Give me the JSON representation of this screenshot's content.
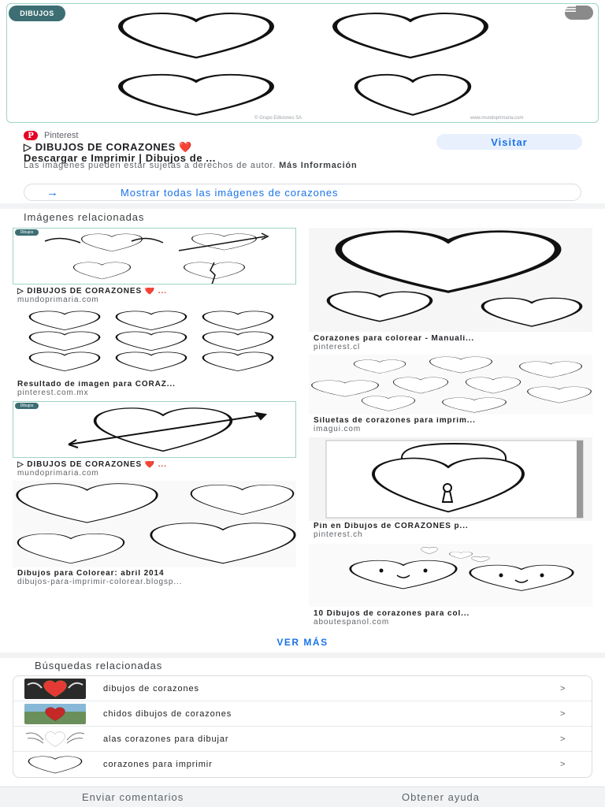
{
  "hero": {
    "logo_text": "DIBUJOS",
    "footer_left": "© Grupo Ediciones SA",
    "footer_right": "www.mundoprimaria.com"
  },
  "result": {
    "source": "Pinterest",
    "title_prefix": "▷ DIBUJOS DE CORAZONES",
    "title_heart": "❤️",
    "title_line2": "Descargar e Imprimir | Dibujos de ...",
    "visit_label": "Visitar",
    "copyright_text": "Las imágenes pueden estar sujetas a derechos de autor.",
    "more_info": "Más Información",
    "show_all_arrow": "→",
    "show_all_label": "Mostrar todas las imágenes de corazones"
  },
  "related_images": {
    "section_title": "Imágenes relacionadas",
    "left": [
      {
        "title": "▷ DIBUJOS DE CORAZONES",
        "heart": "❤️ ...",
        "site": "mundoprimaria.com",
        "badge": "Dibujos"
      },
      {
        "title": "Resultado de imagen para CORAZ...",
        "heart": "",
        "site": "pinterest.com.mx",
        "badge": ""
      },
      {
        "title": "▷ DIBUJOS DE CORAZONES",
        "heart": "❤️ ...",
        "site": "mundoprimaria.com",
        "badge": "Dibujos"
      },
      {
        "title": "Dibujos para Colorear: abril 2014",
        "heart": "",
        "site": "dibujos-para-imprimir-colorear.blogsp...",
        "badge": ""
      }
    ],
    "right": [
      {
        "title": "Corazones para colorear - Manuali...",
        "site": "pinterest.cl"
      },
      {
        "title": "Siluetas de corazones para imprim...",
        "site": "imagui.com"
      },
      {
        "title": "Pin en Dibujos de CORAZONES p...",
        "site": "pinterest.ch"
      },
      {
        "title": "10 Dibujos de corazones para col...",
        "site": "aboutespanol.com"
      }
    ]
  },
  "ver_mas_label": "VER MÁS",
  "related_searches": {
    "section_title": "Búsquedas relacionadas",
    "chevron": ">",
    "items": [
      {
        "label": "dibujos de corazones"
      },
      {
        "label": "chidos dibujos de corazones"
      },
      {
        "label": "alas corazones para dibujar"
      },
      {
        "label": "corazones para imprimir"
      }
    ]
  },
  "footer": {
    "feedback_label": "Enviar comentarios",
    "help_label": "Obtener ayuda"
  },
  "colors": {
    "accent": "#1a73e8",
    "heart_red": "#e53935",
    "pinterest_red": "#e60023"
  }
}
